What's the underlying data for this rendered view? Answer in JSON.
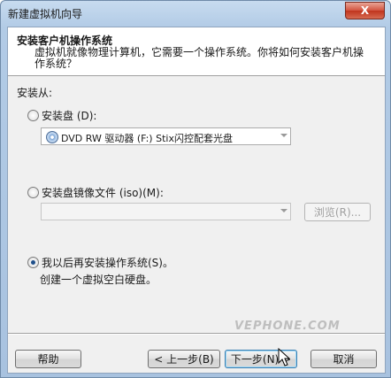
{
  "window": {
    "title": "新建虚拟机向导",
    "close_label": "X"
  },
  "header": {
    "title": "安装客户机操作系统",
    "description": "虚拟机就像物理计算机，它需要一个操作系统。你将如何安装客户机操作系统？"
  },
  "install_from_label": "安装从:",
  "options": {
    "disc": {
      "label": "安装盘 (D):",
      "checked": false,
      "combo_value": "DVD RW 驱动器 (F:) Stix闪控配套光盘"
    },
    "iso": {
      "label": "安装盘镜像文件 (iso)(M):",
      "checked": false,
      "combo_value": "",
      "browse_label": "浏览(R)..."
    },
    "later": {
      "label": "我以后再安装操作系统(S)。",
      "checked": true,
      "description": "创建一个虚拟空白硬盘。"
    }
  },
  "buttons": {
    "help": "帮助",
    "back": "< 上一步(B)",
    "next": "下一步(N) >",
    "cancel": "取消"
  },
  "watermark": "VEPHONE.COM"
}
